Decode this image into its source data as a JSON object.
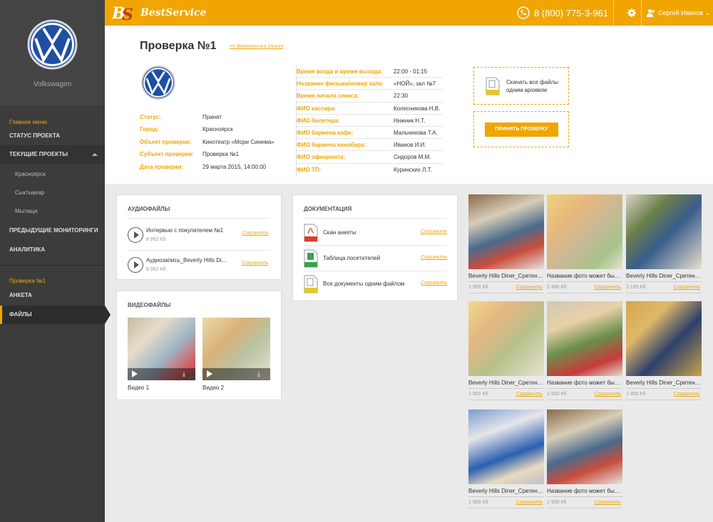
{
  "brand": {
    "name": "Volkswagen"
  },
  "sidebar": {
    "section_main": "Главное меню",
    "items": [
      {
        "label": "Статус проекта"
      },
      {
        "label": "Текущие проекты"
      },
      {
        "label": "Предыдущие мониторинги"
      },
      {
        "label": "Аналитика"
      }
    ],
    "subitems": [
      {
        "label": "Красноярск"
      },
      {
        "label": "Сыктывкар"
      },
      {
        "label": "Мытищи"
      }
    ],
    "section_check": "Проверка №1",
    "check_items": [
      {
        "label": "Анкета"
      },
      {
        "label": "Файлы"
      }
    ]
  },
  "topbar": {
    "logo_text": "BestService",
    "phone": "8 (800) 775-3-961",
    "user": "Сергей Иванов"
  },
  "header": {
    "title": "Проверка №1",
    "back_link": "<< Вернуться к списку",
    "info": [
      {
        "k": "Статус:",
        "v": "Принят"
      },
      {
        "k": "Город:",
        "v": "Красноярск"
      },
      {
        "k": "Объект проверки:",
        "v": "Кинотеатр «Мори Синема»"
      },
      {
        "k": "Субъект проверки:",
        "v": "Проверка №1"
      },
      {
        "k": "Дата проверки:",
        "v": "29 марта 2015, 14:00:00"
      }
    ],
    "details": [
      {
        "k": "Время входа и время выхода:",
        "v": "22:00 - 01:15"
      },
      {
        "k": "Название фильма/номер зала:",
        "v": "«НОЙ», зал №7"
      },
      {
        "k": "Время начала сеанса:",
        "v": "22:30"
      },
      {
        "k": "ФИО кассира:",
        "v": "Колесникова Н.В."
      },
      {
        "k": "ФИО билетера:",
        "v": "Нижник Н.Т."
      },
      {
        "k": "ФИО бармена кафе:",
        "v": "Мальчинова Т.А."
      },
      {
        "k": "ФИО бармена кинобара:",
        "v": "Иванов И.И."
      },
      {
        "k": "ФИО официанта:",
        "v": "Сидоров М.М."
      },
      {
        "k": "ФИО ТП:",
        "v": "Куринских Л.Т."
      }
    ],
    "download_all": "Скачать все файлы одним архивом",
    "accept_button": "Принять проверку"
  },
  "audio": {
    "title": "Аудиофайлы",
    "items": [
      {
        "name": "Интервью с покупателем №1",
        "size": "8 952 Кб",
        "save": "Сохранить"
      },
      {
        "name": "Аудиозапись_Beverly Hills Di...",
        "size": "8 952 Кб",
        "save": "Сохранить"
      }
    ]
  },
  "video": {
    "title": "Видеофайлы",
    "items": [
      {
        "name": "Видео 1"
      },
      {
        "name": "Видео 2"
      }
    ]
  },
  "docs": {
    "title": "Документация",
    "items": [
      {
        "name": "Скан анкеты",
        "type": "PDF",
        "color": "#e03a2e",
        "save": "Сохранить"
      },
      {
        "name": "Таблица посетителей",
        "type": "XLS",
        "color": "#3aa24a",
        "save": "Сохранить"
      },
      {
        "name": "Все документы одним файлом",
        "type": "RAR",
        "color": "#e8c720",
        "save": "Сохранить"
      }
    ]
  },
  "photos": [
    {
      "name": "Beverly Hills Diner_Сретенка...",
      "size": "1 950 Кб",
      "save": "Сохранить"
    },
    {
      "name": "Название фото может быть...",
      "size": "2 486 Кб",
      "save": "Сохранить"
    },
    {
      "name": "Beverly Hills Diner_Сретенка...",
      "size": "3 195 Кб",
      "save": "Сохранить"
    },
    {
      "name": "Beverly Hills Diner_Сретенка...",
      "size": "1 950 Кб",
      "save": "Сохранить"
    },
    {
      "name": "Название фото может быть...",
      "size": "1 950 Кб",
      "save": "Сохранить"
    },
    {
      "name": "Beverly Hills Diner_Сретенка...",
      "size": "1 950 Кб",
      "save": "Сохранить"
    },
    {
      "name": "Beverly Hills Diner_Сретенка...",
      "size": "1 950 Кб",
      "save": "Сохранить"
    },
    {
      "name": "Название фото может быть...",
      "size": "1 950 Кб",
      "save": "Сохранить"
    }
  ],
  "colors": {
    "accent": "#f0a500",
    "sidebar": "#3c3c3c"
  }
}
